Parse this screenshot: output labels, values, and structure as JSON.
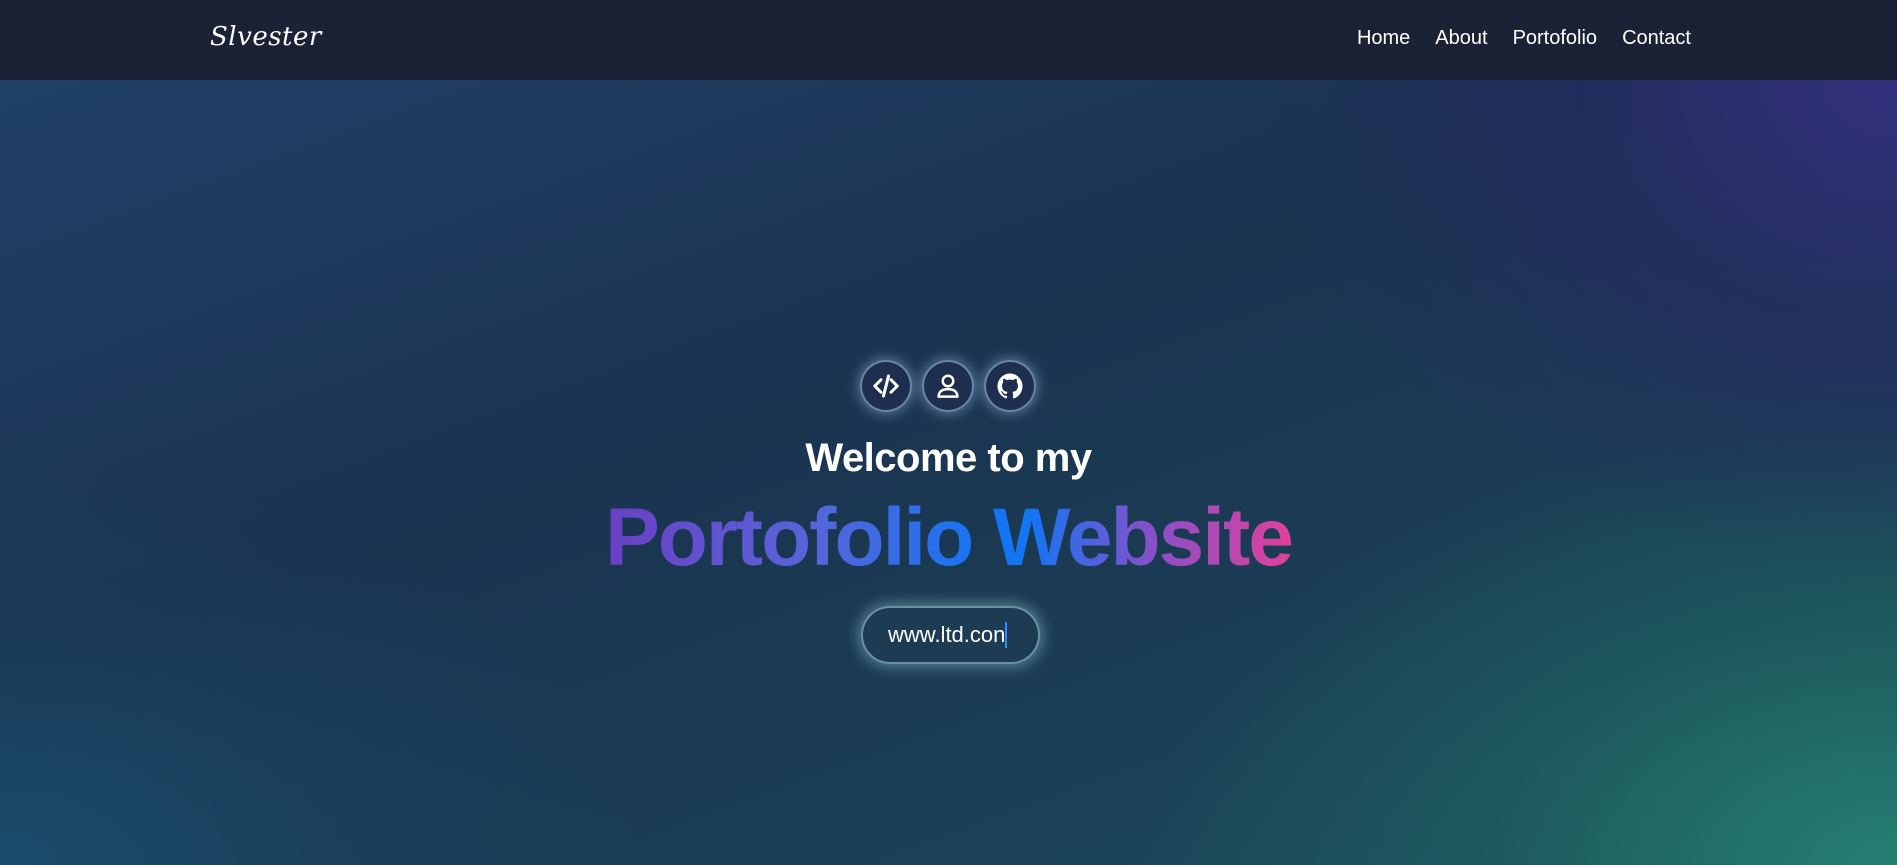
{
  "nav": {
    "brand": "Slvester",
    "links": [
      "Home",
      "About",
      "Portofolio",
      "Contact"
    ]
  },
  "hero": {
    "icons": [
      "code-icon",
      "user-icon",
      "github-icon"
    ],
    "welcome": "Welcome to my",
    "headline": "Portofolio Website",
    "url": "www.ltd.con"
  },
  "colors": {
    "navbar": "#1b2236",
    "gradient_start": "#6a3fc4",
    "gradient_mid": "#1475f3",
    "gradient_end": "#e0409a"
  }
}
